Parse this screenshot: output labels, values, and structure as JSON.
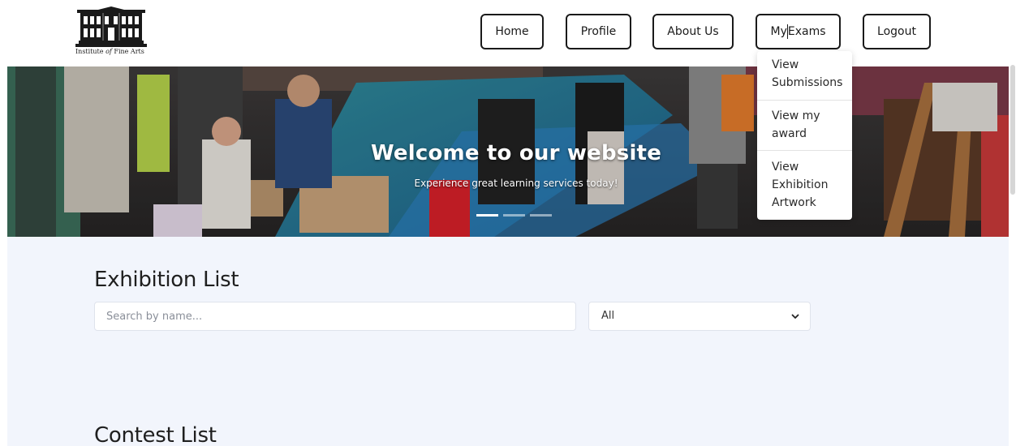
{
  "logo": {
    "text_prefix": "Institute ",
    "text_italic": "of",
    "text_suffix": " Fine Arts"
  },
  "nav": {
    "home": "Home",
    "profile": "Profile",
    "about": "About Us",
    "exams_part1": "My",
    "exams_part2": "Exams",
    "logout": "Logout"
  },
  "dropdown": {
    "item1_line1": "View",
    "item1_line2": "Submissions",
    "item2_line1": "View my",
    "item2_line2": "award",
    "item3_line1": "View",
    "item3_line2": "Exhibition",
    "item3_line3": "Artwork"
  },
  "hero": {
    "title": "Welcome to our website",
    "subtitle": "Experience great learning services today!",
    "active_slide": 1,
    "slide_count": 3
  },
  "exhibition": {
    "title": "Exhibition List",
    "search_placeholder": "Search by name...",
    "filter_value": "All"
  },
  "contest": {
    "title": "Contest List"
  },
  "colors": {
    "page_bg": "#ffffff",
    "content_bg": "#f2f5fc",
    "button_border": "#1a1a1a",
    "text": "#1f1f1f"
  },
  "icons": {
    "logo": "building-icon",
    "select": "chevron-down-icon"
  }
}
